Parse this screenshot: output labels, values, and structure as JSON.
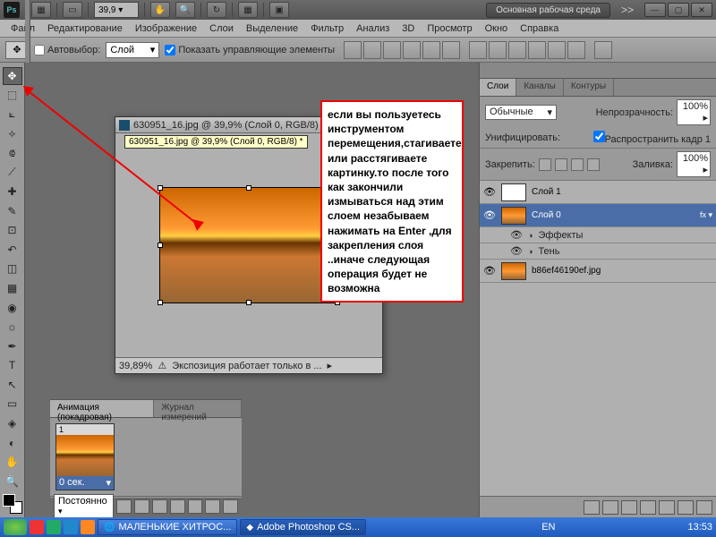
{
  "titlebar": {
    "logo": "Ps",
    "zoom": "39,9 ▾",
    "workspace": "Основная рабочая среда",
    "chevrons": ">>"
  },
  "menu": [
    "Файл",
    "Редактирование",
    "Изображение",
    "Слои",
    "Выделение",
    "Фильтр",
    "Анализ",
    "3D",
    "Просмотр",
    "Окно",
    "Справка"
  ],
  "options": {
    "autoselect": "Автовыбор:",
    "autoselect_val": "Слой",
    "show_controls": "Показать управляющие элементы"
  },
  "doc": {
    "title": "630951_16.jpg @ 39,9% (Слой 0, RGB/8) *",
    "tooltip": "630951_16.jpg @ 39,9% (Слой 0, RGB/8) *",
    "zoom": "39,89%",
    "status": "Экспозиция работает только в ..."
  },
  "annotation": "если вы пользуетесь инструментом перемещения,стагиваете или расстягиваете картинку.то после того как закончили измываться над этим слоем незабываем нажимать на Enter ,для закрепления слоя ..иначе следующая операция будет не возможна",
  "panels": {
    "tabs": [
      "Слои",
      "Каналы",
      "Контуры"
    ],
    "blend": "Обычные",
    "opacity_lbl": "Непрозрачность:",
    "opacity": "100% ▸",
    "unify": "Унифицировать:",
    "propagate": "Распространить кадр 1",
    "lock_lbl": "Закрепить:",
    "fill_lbl": "Заливка:",
    "fill": "100% ▸",
    "layers": [
      {
        "name": "Слой 1"
      },
      {
        "name": "Слой 0"
      },
      {
        "name": "b86ef46190ef.jpg"
      }
    ],
    "fx": "Эффекты",
    "fx_shadow": "Тень"
  },
  "anim": {
    "tabs": [
      "Анимация (покадровая)",
      "Журнал измерений"
    ],
    "frame_num": "1",
    "duration": "0 сек.",
    "loop": "Постоянно"
  },
  "taskbar": {
    "task1": "МАЛЕНЬКИЕ ХИТРОС...",
    "task2": "Adobe Photoshop CS...",
    "lang": "EN",
    "clock": "13:53"
  }
}
